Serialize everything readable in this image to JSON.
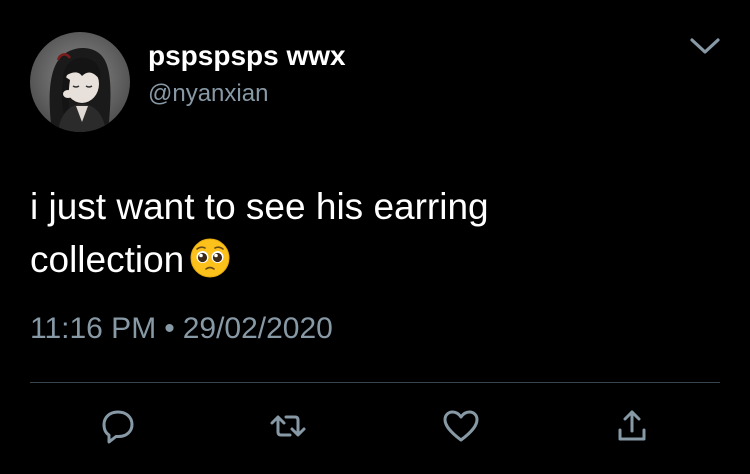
{
  "user": {
    "display_name": "pspspsps wwx",
    "handle": "@nyanxian",
    "avatar": "anime-character-avatar"
  },
  "tweet": {
    "line1": "i just want to see his earring",
    "line2": "collection",
    "emoji": "pleading-face-emoji"
  },
  "meta": {
    "time": "11:16 PM",
    "separator": "•",
    "date": "29/02/2020"
  },
  "icons": {
    "menu": "chevron-down-icon",
    "reply": "reply-icon",
    "retweet": "retweet-icon",
    "like": "heart-icon",
    "share": "share-icon"
  },
  "colors": {
    "background": "#000000",
    "text": "#ffffff",
    "secondary": "#8899a6",
    "divider": "#38444d"
  }
}
